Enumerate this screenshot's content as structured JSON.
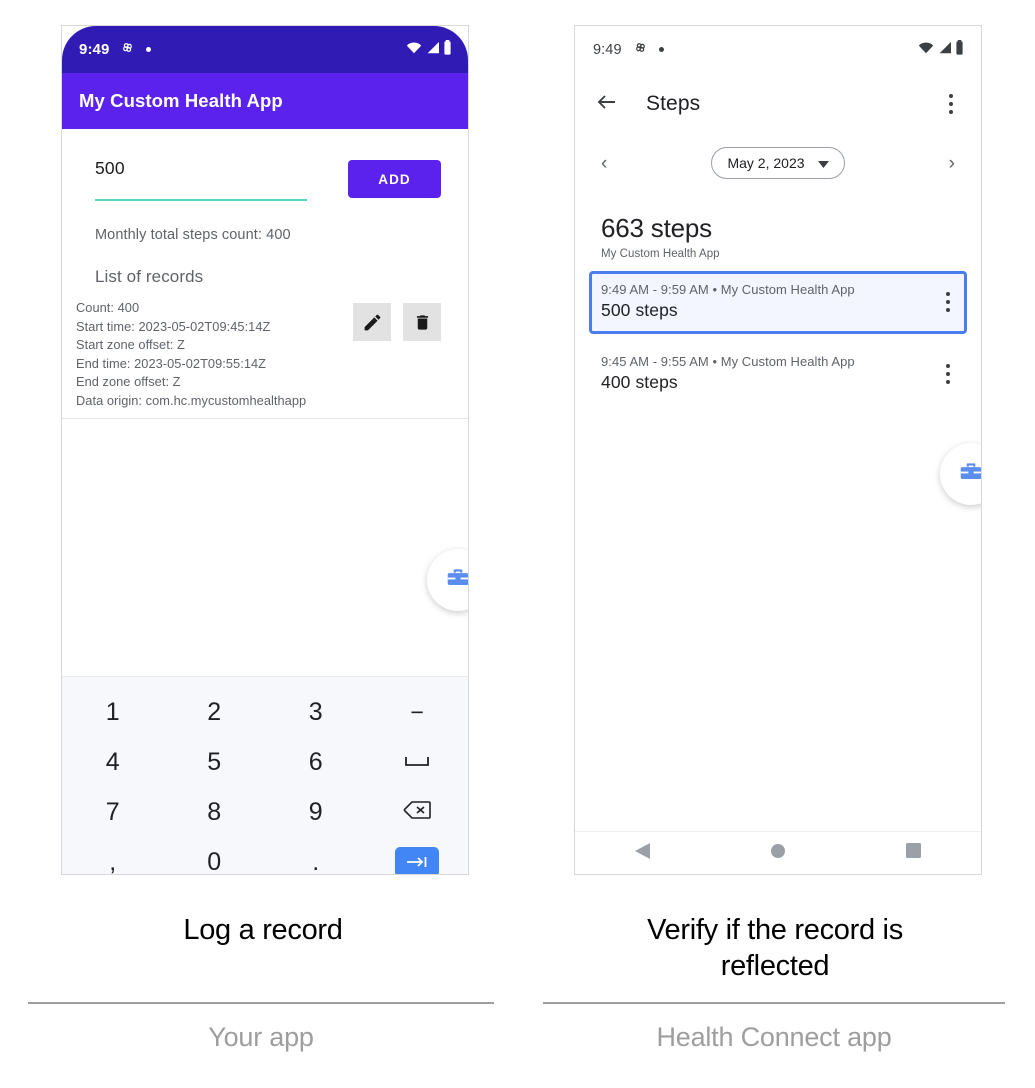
{
  "left_phone": {
    "status_bar": {
      "time": "9:49",
      "icons": [
        "pinwheel-icon",
        "dot-indicator",
        "wifi-icon",
        "signal-icon",
        "battery-icon"
      ]
    },
    "app_bar": {
      "title": "My Custom Health App"
    },
    "input": {
      "value": "500",
      "underline_color": "#55d6be"
    },
    "add_button": {
      "label": "ADD",
      "color": "#5b22ee"
    },
    "monthly_total": "Monthly total steps count: 400",
    "list_title": "List of records",
    "record": {
      "lines": [
        "Count: 400",
        "Start time: 2023-05-02T09:45:14Z",
        "Start zone offset: Z",
        "End time: 2023-05-02T09:55:14Z",
        "End zone offset: Z",
        "Data origin: com.hc.mycustomhealthapp"
      ],
      "actions": [
        "edit-icon",
        "delete-icon"
      ]
    },
    "fab": {
      "icon": "toolbox-icon",
      "color": "#5b8def"
    },
    "keyboard": {
      "rows": [
        [
          "1",
          "2",
          "3",
          "−"
        ],
        [
          "4",
          "5",
          "6",
          "␣"
        ],
        [
          "7",
          "8",
          "9",
          "⌫"
        ],
        [
          ",",
          "0",
          ".",
          "→|"
        ]
      ],
      "enter_color": "#4285f4"
    },
    "nav_bar": [
      "dismiss-keyboard-icon",
      "home-icon",
      "recents-icon",
      "keyboard-switcher-icon"
    ]
  },
  "right_phone": {
    "status_bar": {
      "time": "9:49",
      "icons": [
        "pinwheel-icon",
        "dot-indicator",
        "wifi-icon",
        "signal-icon",
        "battery-icon"
      ]
    },
    "app_bar": {
      "back_icon": "back-arrow-icon",
      "title": "Steps",
      "overflow_icon": "overflow-menu-icon"
    },
    "date_nav": {
      "prev": "‹",
      "date": "May 2, 2023",
      "dropdown": "▾",
      "next": "›"
    },
    "total": {
      "value": "663 steps",
      "source": "My Custom Health App"
    },
    "records": [
      {
        "time_range": "9:49 AM - 9:59 AM • My Custom Health App",
        "steps": "500 steps",
        "selected": true
      },
      {
        "time_range": "9:45 AM - 9:55 AM • My Custom Health App",
        "steps": "400 steps",
        "selected": false
      }
    ],
    "selection_color": "#4c7df0",
    "fab": {
      "icon": "toolbox-icon",
      "color": "#5b8def"
    },
    "nav_bar": [
      "back-icon",
      "home-icon",
      "recents-icon"
    ]
  },
  "captions": {
    "left": "Log a record",
    "right_line1": "Verify if the record is",
    "right_line2": "reflected"
  },
  "footers": {
    "left": "Your app",
    "right": "Health Connect app"
  }
}
